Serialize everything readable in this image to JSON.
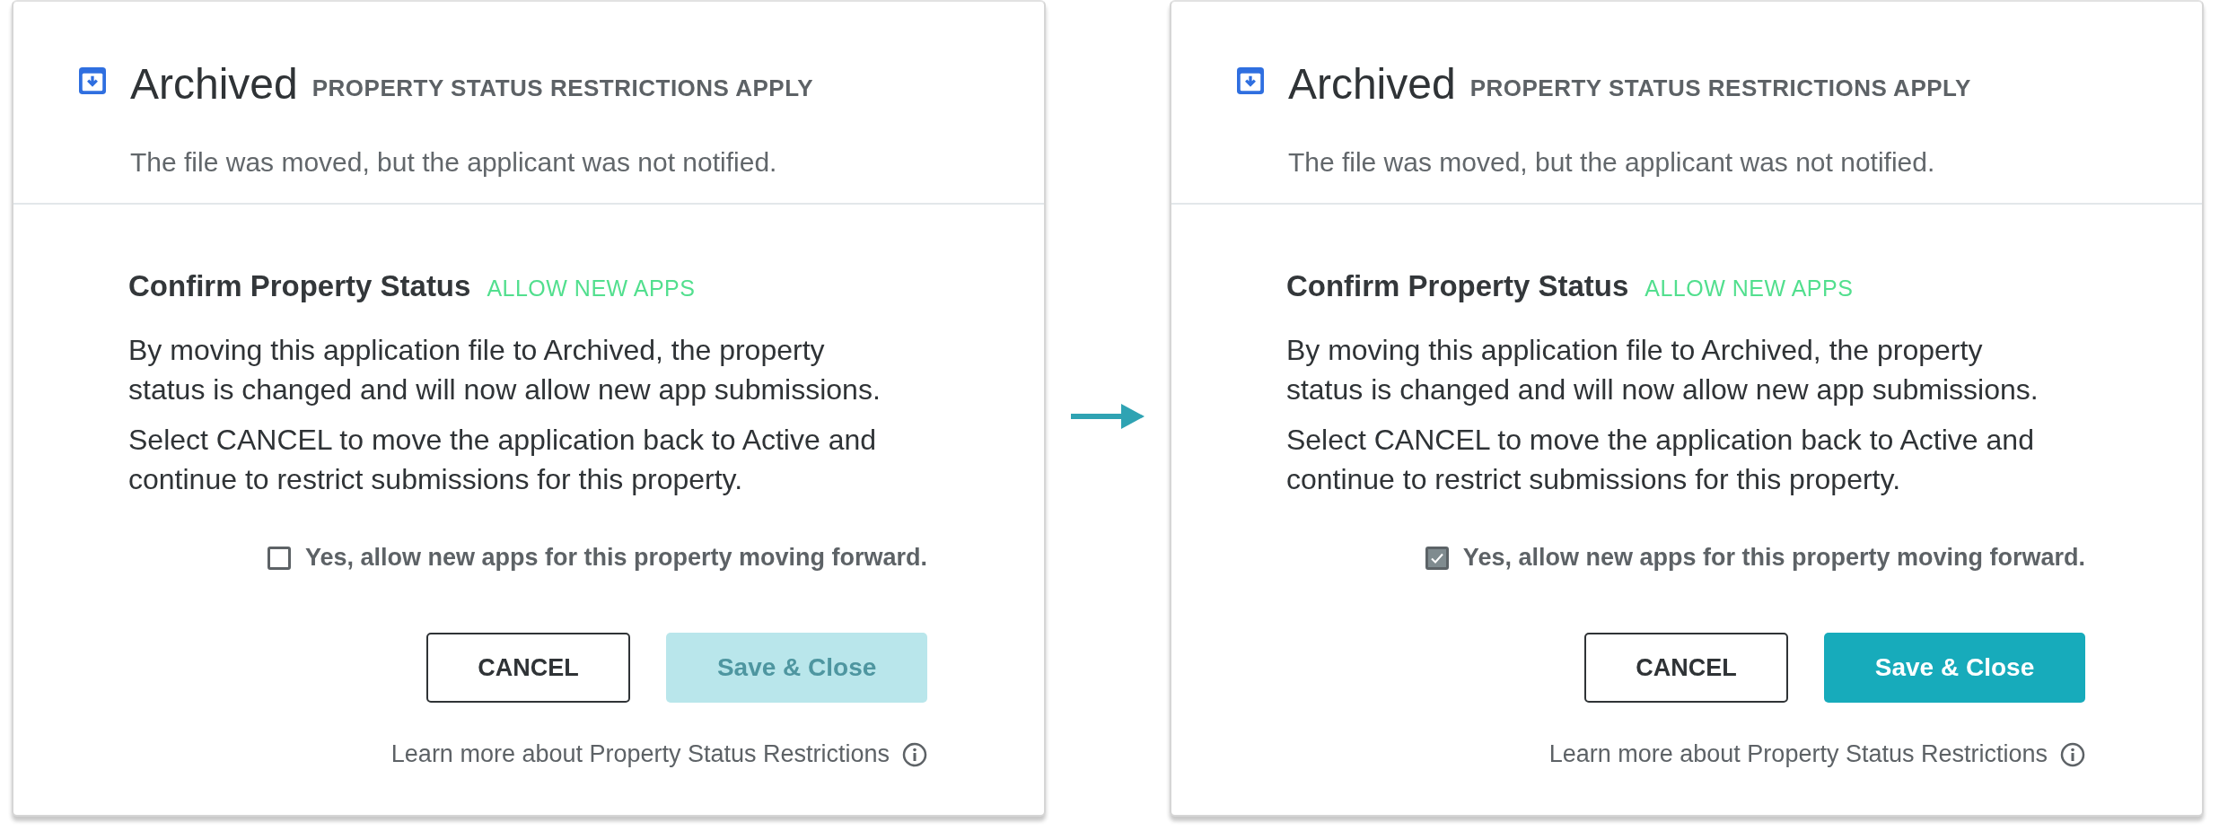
{
  "panels": [
    {
      "status_title": "Archived",
      "status_tag": "PROPERTY STATUS RESTRICTIONS APPLY",
      "status_note": "The file was moved, but the applicant was not notified.",
      "confirm_title": "Confirm Property Status",
      "confirm_tag": "ALLOW NEW APPS",
      "paragraphs": [
        "By moving this application file to Archived, the property status is changed and will now allow new app submissions.",
        "Select CANCEL to move the application back to Active and continue to restrict submissions for this property."
      ],
      "checkbox": {
        "label": "Yes, allow new apps for this property moving forward.",
        "checked": false
      },
      "cancel_button": "CANCEL",
      "save_button": {
        "label": "Save & Close",
        "disabled": true
      },
      "learn_more": "Learn more about Property Status Restrictions"
    },
    {
      "status_title": "Archived",
      "status_tag": "PROPERTY STATUS RESTRICTIONS APPLY",
      "status_note": "The file was moved, but the applicant was not notified.",
      "confirm_title": "Confirm Property Status",
      "confirm_tag": "ALLOW NEW APPS",
      "paragraphs": [
        "By moving this application file to Archived, the property status is changed and will now allow new app submissions.",
        "Select CANCEL to move the application back to Active and continue to restrict submissions for this property."
      ],
      "checkbox": {
        "label": "Yes, allow new apps for this property moving forward.",
        "checked": true
      },
      "cancel_button": "CANCEL",
      "save_button": {
        "label": "Save & Close",
        "disabled": false
      },
      "learn_more": "Learn more about Property Status Restrictions"
    }
  ]
}
